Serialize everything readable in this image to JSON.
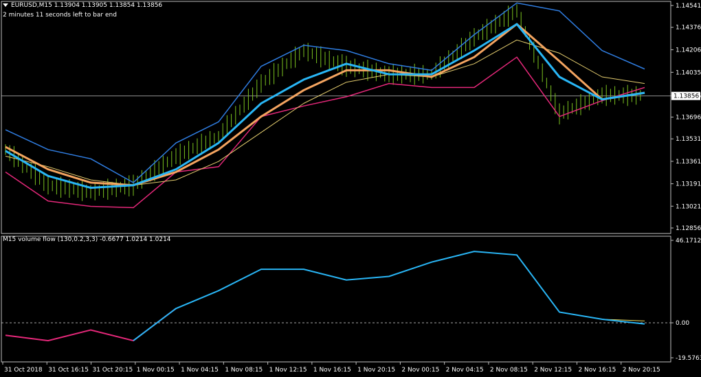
{
  "header": {
    "symbol_line": "EURUSD,M15  1.13904 1.13905 1.13854 1.13856",
    "timer": "2 minutes 11 seconds left to bar end"
  },
  "price_panel": {
    "yticks": [
      "1.14541",
      "1.14376",
      "1.14206",
      "1.14035",
      "1.13856",
      "1.13696",
      "1.13531",
      "1.13361",
      "1.13191",
      "1.13021",
      "1.12856"
    ],
    "last_price_label": "1.13856"
  },
  "indicator_panel": {
    "title": "M15 volume flow (130,0.2,3,3) -0.6677 1.0214 1.0214",
    "yticks": [
      "46.1712",
      "0.00",
      "-19.5763"
    ]
  },
  "xaxis": {
    "ticks": [
      "31 Oct 2018",
      "31 Oct 16:15",
      "31 Oct 20:15",
      "1 Nov 00:15",
      "1 Nov 04:15",
      "1 Nov 08:15",
      "1 Nov 12:15",
      "1 Nov 16:15",
      "1 Nov 20:15",
      "2 Nov 00:15",
      "2 Nov 04:15",
      "2 Nov 08:15",
      "2 Nov 12:15",
      "2 Nov 16:15",
      "2 Nov 20:15"
    ]
  },
  "colors": {
    "background": "#000000",
    "candles": "#7cc41f",
    "fast_ma": "#29b6f6",
    "slow_ma": "#f4a460",
    "thin_ma": "#e8d070",
    "upper_band": "#2f7de1",
    "lower_band": "#e6287a",
    "flow_line": "#29b6f6",
    "flow_signal": "#f0e060",
    "axis": "#c0c0c0"
  },
  "chart_data": [
    {
      "type": "line",
      "panel": "price",
      "ylim": [
        1.12856,
        1.14541
      ],
      "x": [
        "31 Oct 2018",
        "31 Oct 16:15",
        "31 Oct 20:15",
        "1 Nov 00:15",
        "1 Nov 04:15",
        "1 Nov 08:15",
        "1 Nov 12:15",
        "1 Nov 16:15",
        "1 Nov 20:15",
        "2 Nov 00:15",
        "2 Nov 04:15",
        "2 Nov 08:15",
        "2 Nov 12:15",
        "2 Nov 16:15",
        "2 Nov 20:15",
        "end"
      ],
      "series": [
        {
          "key": "price",
          "values": [
            1.1345,
            1.1318,
            1.1313,
            1.1318,
            1.134,
            1.1355,
            1.1395,
            1.142,
            1.1408,
            1.1402,
            1.1402,
            1.143,
            1.145,
            1.1372,
            1.1386,
            1.1386
          ]
        },
        {
          "key": "fast_ma",
          "values": [
            1.1344,
            1.1325,
            1.1316,
            1.1318,
            1.133,
            1.135,
            1.138,
            1.1398,
            1.141,
            1.1402,
            1.1402,
            1.142,
            1.144,
            1.14,
            1.1383,
            1.1388
          ]
        },
        {
          "key": "slow_ma",
          "values": [
            1.1347,
            1.133,
            1.132,
            1.1318,
            1.1328,
            1.1345,
            1.137,
            1.139,
            1.1405,
            1.1405,
            1.14,
            1.1415,
            1.144,
            1.1412,
            1.1383,
            1.1388
          ]
        },
        {
          "key": "thin_ma",
          "values": [
            1.134,
            1.1332,
            1.1322,
            1.1318,
            1.1322,
            1.1336,
            1.1358,
            1.138,
            1.1396,
            1.1402,
            1.14,
            1.141,
            1.1428,
            1.1418,
            1.14,
            1.1395
          ]
        },
        {
          "key": "upper_band",
          "values": [
            1.136,
            1.1345,
            1.1338,
            1.132,
            1.135,
            1.1366,
            1.1408,
            1.1424,
            1.142,
            1.141,
            1.1405,
            1.1432,
            1.1456,
            1.145,
            1.142,
            1.1406
          ]
        },
        {
          "key": "lower_band",
          "values": [
            1.1328,
            1.1306,
            1.1302,
            1.1301,
            1.1328,
            1.1332,
            1.137,
            1.1378,
            1.1385,
            1.1395,
            1.1392,
            1.1392,
            1.1415,
            1.137,
            1.1382,
            1.1392
          ]
        }
      ]
    },
    {
      "type": "line",
      "panel": "indicator",
      "ylim": [
        -19.5763,
        46.1712
      ],
      "x": [
        "31 Oct 2018",
        "31 Oct 16:15",
        "31 Oct 20:15",
        "1 Nov 00:15",
        "1 Nov 04:15",
        "1 Nov 08:15",
        "1 Nov 12:15",
        "1 Nov 16:15",
        "1 Nov 20:15",
        "2 Nov 00:15",
        "2 Nov 04:15",
        "2 Nov 08:15",
        "2 Nov 12:15",
        "2 Nov 16:15",
        "2 Nov 20:15",
        "end"
      ],
      "series": [
        {
          "key": "flow",
          "values": [
            -7,
            -10,
            -4,
            -10,
            8,
            18,
            30,
            30,
            24,
            26,
            34,
            40,
            38,
            6,
            2,
            -0.67
          ]
        },
        {
          "key": "signal",
          "values": [
            -7,
            -10,
            -4,
            -10,
            8,
            18,
            30,
            30,
            24,
            26,
            34,
            40,
            38,
            6,
            2,
            1.02
          ]
        }
      ]
    }
  ]
}
